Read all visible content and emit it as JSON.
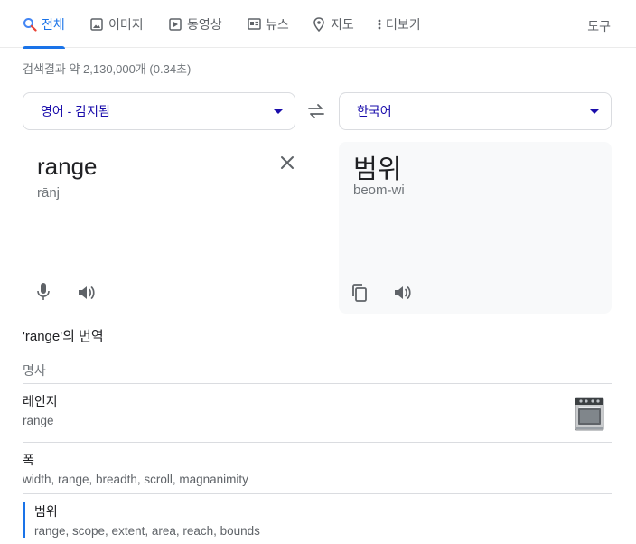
{
  "tabs": [
    {
      "label": "전체",
      "icon": "search-icon",
      "active": true
    },
    {
      "label": "이미지",
      "icon": "image-icon",
      "active": false
    },
    {
      "label": "동영상",
      "icon": "play-icon",
      "active": false
    },
    {
      "label": "뉴스",
      "icon": "news-icon",
      "active": false
    },
    {
      "label": "지도",
      "icon": "map-pin-icon",
      "active": false
    },
    {
      "label": "더보기",
      "icon": "more-vert-icon",
      "active": false
    }
  ],
  "tools_label": "도구",
  "result_stats": "검색결과 약 2,130,000개 (0.34초)",
  "translator": {
    "source_lang": "영어 - 감지됨",
    "target_lang": "한국어",
    "source_text": "range",
    "source_pron": "rānj",
    "target_text": "범위",
    "target_pron": "beom-wi"
  },
  "translations": {
    "heading": "'range'의 번역",
    "part_of_speech": "명사",
    "entries": [
      {
        "word": "레인지",
        "synonyms": "range"
      },
      {
        "word": "폭",
        "synonyms": "width, range, breadth, scroll, magnanimity"
      },
      {
        "word": "범위",
        "synonyms": "range, scope, extent, area, reach, bounds"
      }
    ]
  },
  "colors": {
    "accent": "#1a73e8",
    "link": "#1a0dab",
    "muted": "#70757a",
    "panel_bg": "#f8f9fa"
  }
}
